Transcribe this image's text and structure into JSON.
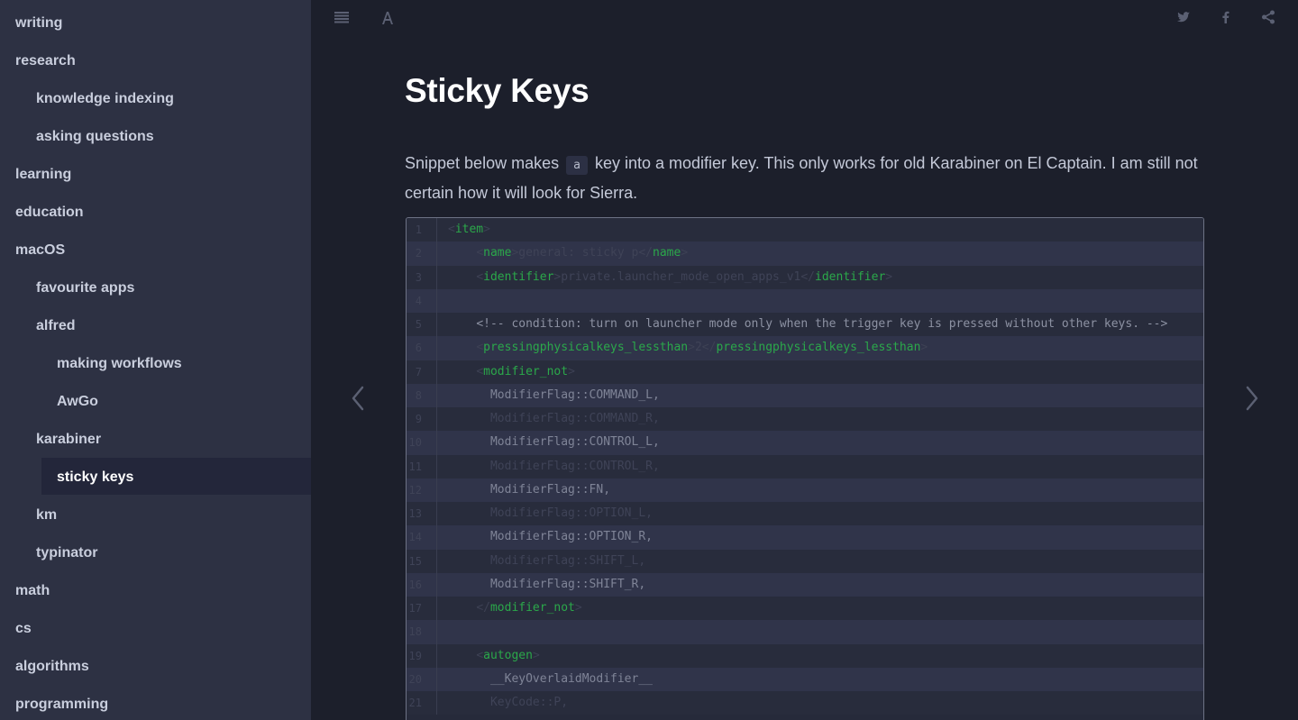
{
  "sidebar": {
    "items": [
      {
        "label": "writing",
        "level": 0
      },
      {
        "label": "research",
        "level": 0
      },
      {
        "label": "knowledge indexing",
        "level": 1
      },
      {
        "label": "asking questions",
        "level": 1
      },
      {
        "label": "learning",
        "level": 0
      },
      {
        "label": "education",
        "level": 0
      },
      {
        "label": "macOS",
        "level": 0
      },
      {
        "label": "favourite apps",
        "level": 1
      },
      {
        "label": "alfred",
        "level": 1
      },
      {
        "label": "making workflows",
        "level": 2
      },
      {
        "label": "AwGo",
        "level": 2
      },
      {
        "label": "karabiner",
        "level": 1
      },
      {
        "label": "sticky keys",
        "level": 2,
        "active": true
      },
      {
        "label": "km",
        "level": 1
      },
      {
        "label": "typinator",
        "level": 1
      },
      {
        "label": "math",
        "level": 0
      },
      {
        "label": "cs",
        "level": 0
      },
      {
        "label": "algorithms",
        "level": 0
      },
      {
        "label": "programming",
        "level": 0
      }
    ]
  },
  "header": {
    "icons": [
      "menu-icon",
      "font-settings-icon",
      "twitter-icon",
      "facebook-icon",
      "share-icon"
    ]
  },
  "page": {
    "title": "Sticky Keys",
    "intro_before": "Snippet below makes",
    "intro_code": "a",
    "intro_after": "key into a modifier key. This only works for old Karabiner on El Captain. I am still not certain how it will look for Sierra."
  },
  "code": {
    "lines": [
      {
        "n": "1",
        "parts": [
          [
            "p",
            "<"
          ],
          [
            "t",
            "item"
          ],
          [
            "p",
            ">"
          ]
        ]
      },
      {
        "n": "2",
        "parts": [
          [
            "s",
            "    "
          ],
          [
            "p",
            "<"
          ],
          [
            "t",
            "name"
          ],
          [
            "p",
            ">"
          ],
          [
            "d",
            "general: sticky p</"
          ],
          [
            "t",
            "name"
          ],
          [
            "p",
            ">"
          ]
        ]
      },
      {
        "n": "3",
        "parts": [
          [
            "s",
            "    "
          ],
          [
            "p",
            "<"
          ],
          [
            "t",
            "identifier"
          ],
          [
            "p",
            ">"
          ],
          [
            "d",
            "private.launcher_mode_open_apps_v1"
          ],
          [
            "p",
            "</"
          ],
          [
            "t",
            "identifier"
          ],
          [
            "p",
            ">"
          ]
        ]
      },
      {
        "n": "4",
        "parts": []
      },
      {
        "n": "5",
        "parts": [
          [
            "s",
            "    "
          ],
          [
            "c",
            "<!-- condition: turn on launcher mode only when the trigger key is pressed without other keys. -->"
          ]
        ]
      },
      {
        "n": "6",
        "parts": [
          [
            "s",
            "    "
          ],
          [
            "p",
            "<"
          ],
          [
            "t",
            "pressingphysicalkeys_lessthan"
          ],
          [
            "p",
            ">"
          ],
          [
            "d",
            "2"
          ],
          [
            "p",
            "</"
          ],
          [
            "t",
            "pressingphysicalkeys_lessthan"
          ],
          [
            "p",
            ">"
          ]
        ]
      },
      {
        "n": "7",
        "parts": [
          [
            "s",
            "    "
          ],
          [
            "p",
            "<"
          ],
          [
            "t",
            "modifier_not"
          ],
          [
            "p",
            ">"
          ]
        ]
      },
      {
        "n": "8",
        "parts": [
          [
            "s",
            "      "
          ],
          [
            "x",
            "ModifierFlag::COMMAND_L,"
          ]
        ]
      },
      {
        "n": "9",
        "parts": [
          [
            "s",
            "      "
          ],
          [
            "d",
            "ModifierFlag::COMMAND_R,"
          ]
        ]
      },
      {
        "n": "10",
        "parts": [
          [
            "s",
            "      "
          ],
          [
            "x",
            "ModifierFlag::CONTROL_L,"
          ]
        ]
      },
      {
        "n": "11",
        "parts": [
          [
            "s",
            "      "
          ],
          [
            "d",
            "ModifierFlag::CONTROL_R,"
          ]
        ]
      },
      {
        "n": "12",
        "parts": [
          [
            "s",
            "      "
          ],
          [
            "x",
            "ModifierFlag::FN,"
          ]
        ]
      },
      {
        "n": "13",
        "parts": [
          [
            "s",
            "      "
          ],
          [
            "d",
            "ModifierFlag::OPTION_L,"
          ]
        ]
      },
      {
        "n": "14",
        "parts": [
          [
            "s",
            "      "
          ],
          [
            "x",
            "ModifierFlag::OPTION_R,"
          ]
        ]
      },
      {
        "n": "15",
        "parts": [
          [
            "s",
            "      "
          ],
          [
            "d",
            "ModifierFlag::SHIFT_L,"
          ]
        ]
      },
      {
        "n": "16",
        "parts": [
          [
            "s",
            "      "
          ],
          [
            "x",
            "ModifierFlag::SHIFT_R,"
          ]
        ]
      },
      {
        "n": "17",
        "parts": [
          [
            "s",
            "    "
          ],
          [
            "p",
            "</"
          ],
          [
            "t",
            "modifier_not"
          ],
          [
            "p",
            ">"
          ]
        ]
      },
      {
        "n": "18",
        "parts": []
      },
      {
        "n": "19",
        "parts": [
          [
            "s",
            "    "
          ],
          [
            "p",
            "<"
          ],
          [
            "t",
            "autogen"
          ],
          [
            "p",
            ">"
          ]
        ]
      },
      {
        "n": "20",
        "parts": [
          [
            "s",
            "      "
          ],
          [
            "x",
            "__KeyOverlaidModifier__"
          ]
        ]
      },
      {
        "n": "21",
        "parts": [
          [
            "s",
            "      "
          ],
          [
            "d",
            "KeyCode::P,"
          ]
        ]
      }
    ]
  },
  "colors": {
    "sidebar_bg": "#2d3143",
    "main_bg": "#1c1f2b",
    "tag_green": "#2ba84a"
  }
}
